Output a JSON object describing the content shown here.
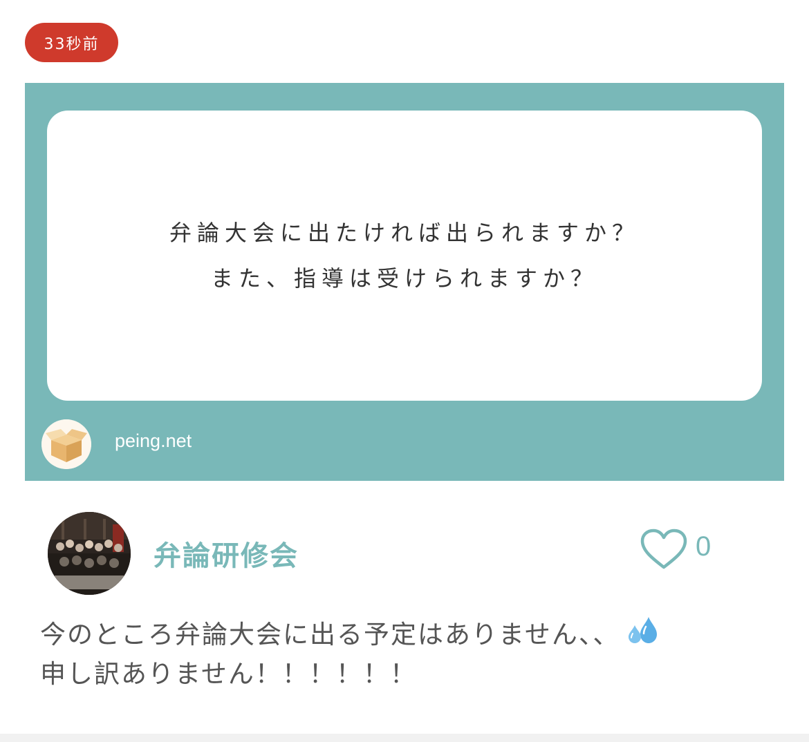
{
  "badge": {
    "time_ago": "33秒前",
    "color": "#cf3a2c"
  },
  "question_card": {
    "background_color": "#79b8b8",
    "lines": [
      "弁論大会に出たければ出られますか？",
      "また、指導は受けられますか？"
    ],
    "site_label": "peing.net",
    "site_icon": "cardboard-box-icon"
  },
  "answer": {
    "user_name": "弁論研修会",
    "like_icon": "heart-outline-icon",
    "like_count": "0",
    "lines": [
      "今のところ弁論大会に出る予定はありません、、",
      "申し訳ありません！！！！！！"
    ],
    "emoji_icon": "sweat-droplets-icon",
    "accent_color": "#79b8b8"
  }
}
